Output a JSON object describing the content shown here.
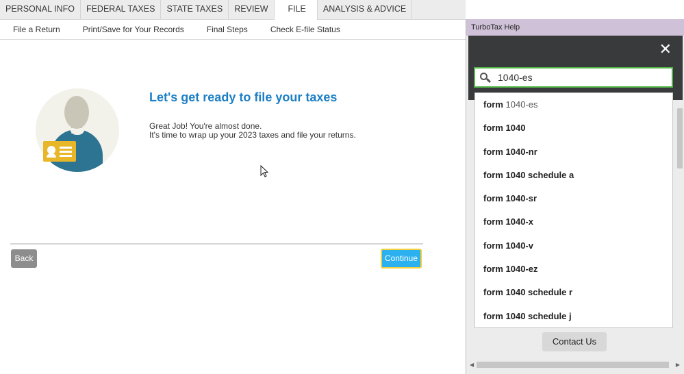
{
  "top_tabs": [
    {
      "label": "PERSONAL INFO"
    },
    {
      "label": "FEDERAL TAXES"
    },
    {
      "label": "STATE TAXES"
    },
    {
      "label": "REVIEW"
    },
    {
      "label": "FILE",
      "active": true
    },
    {
      "label": "ANALYSIS & ADVICE"
    }
  ],
  "sub_nav": [
    {
      "label": "File a Return"
    },
    {
      "label": "Print/Save for Your Records"
    },
    {
      "label": "Final Steps"
    },
    {
      "label": "Check E-file Status"
    }
  ],
  "main": {
    "title": "Let's get ready to file your taxes",
    "line1": "Great Job! You're almost done.",
    "line2": "It's time to wrap up your 2023 taxes and file your returns.",
    "back_label": "Back",
    "continue_label": "Continue"
  },
  "help": {
    "window_title": "TurboTax Help",
    "search_value": "1040-es",
    "suggestions": [
      {
        "bold": "form",
        "rest": " 1040-es"
      },
      {
        "bold": "form 1040",
        "rest": ""
      },
      {
        "bold": "form 1040-nr",
        "rest": ""
      },
      {
        "bold": "form 1040 schedule a",
        "rest": ""
      },
      {
        "bold": "form 1040-sr",
        "rest": ""
      },
      {
        "bold": "form 1040-x",
        "rest": ""
      },
      {
        "bold": "form 1040-v",
        "rest": ""
      },
      {
        "bold": "form 1040-ez",
        "rest": ""
      },
      {
        "bold": "form 1040 schedule r",
        "rest": ""
      },
      {
        "bold": "form 1040 schedule j",
        "rest": ""
      }
    ],
    "contact_label": "Contact Us"
  },
  "icons": {
    "close": "close-icon",
    "search": "search-icon",
    "user": "user-avatar-icon",
    "id_card": "id-card-icon",
    "cursor": "mouse-pointer-icon"
  },
  "colors": {
    "title_blue": "#1c7fc4",
    "continue_bg": "#2bb0f0",
    "continue_border": "#f3d03e",
    "search_border": "#52b548",
    "help_titlebar": "#cfc2d8",
    "help_dark": "#393a3c"
  }
}
